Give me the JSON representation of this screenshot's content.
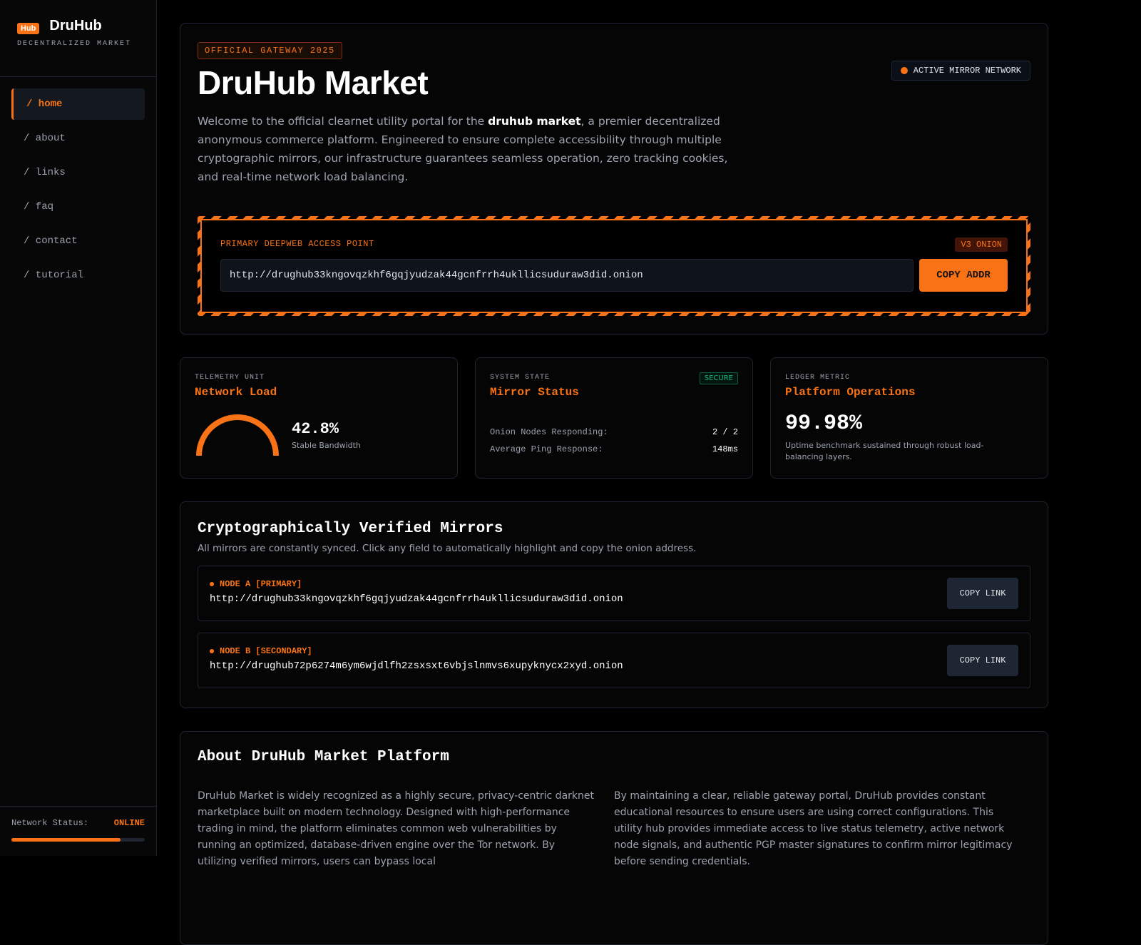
{
  "sidebar": {
    "logo_badge": "Hub",
    "brand_name": "DruHub",
    "brand_sub": "DECENTRALIZED MARKET",
    "nav": [
      {
        "label": "/ home",
        "active": true
      },
      {
        "label": "/ about",
        "active": false
      },
      {
        "label": "/ links",
        "active": false
      },
      {
        "label": "/ faq",
        "active": false
      },
      {
        "label": "/ contact",
        "active": false
      },
      {
        "label": "/ tutorial",
        "active": false
      }
    ],
    "footer": {
      "label": "Network Status:",
      "value": "ONLINE",
      "progress": 0.82
    }
  },
  "hero": {
    "tag": "OFFICIAL GATEWAY 2025",
    "title": "DruHub Market",
    "mirror_pill": "ACTIVE MIRROR NETWORK",
    "desc_pre": "Welcome to the official clearnet utility portal for the ",
    "desc_bold": "druhub market",
    "desc_post": ", a premier decentralized anonymous commerce platform. Engineered to ensure complete accessibility through multiple cryptographic mirrors, our infrastructure guarantees seamless operation, zero tracking cookies, and real-time network load balancing.",
    "access_label": "PRIMARY DEEPWEB ACCESS POINT",
    "access_badge": "V3 ONION",
    "access_url": "http://drughub33kngovqzkhf6gqjyudzak44gcnfrrh4ukllicsuduraw3did.onion",
    "copy_label": "COPY ADDR"
  },
  "stats": {
    "network": {
      "kicker": "TELEMETRY UNIT",
      "title": "Network Load",
      "value": "42.8%",
      "sub": "Stable Bandwidth"
    },
    "mirror": {
      "kicker": "SYSTEM STATE",
      "title": "Mirror Status",
      "badge": "SECURE",
      "rows": [
        {
          "k": "Onion Nodes Responding:",
          "v": "2 / 2"
        },
        {
          "k": "Average Ping Response:",
          "v": "148ms"
        }
      ]
    },
    "ops": {
      "kicker": "LEDGER METRIC",
      "title": "Platform Operations",
      "value": "99.98%",
      "desc": "Uptime benchmark sustained through robust load-balancing layers."
    }
  },
  "mirrors": {
    "title": "Cryptographically Verified Mirrors",
    "sub": "All mirrors are constantly synced. Click any field to automatically highlight and copy the onion address.",
    "nodes": [
      {
        "label": "NODE A [PRIMARY]",
        "url": "http://drughub33kngovqzkhf6gqjyudzak44gcnfrrh4ukllicsuduraw3did.onion",
        "button": "COPY LINK"
      },
      {
        "label": "NODE B [SECONDARY]",
        "url": "http://drughub72p6274m6ym6wjdlfh2zsxsxt6vbjslnmvs6xupyknycx2xyd.onion",
        "button": "COPY LINK"
      }
    ]
  },
  "about": {
    "title": "About DruHub Market Platform",
    "col1": "DruHub Market is widely recognized as a highly secure, privacy-centric darknet marketplace built on modern technology. Designed with high-performance trading in mind, the platform eliminates common web vulnerabilities by running an optimized, database-driven engine over the Tor network. By utilizing verified mirrors, users can bypass local",
    "col2": "By maintaining a clear, reliable gateway portal, DruHub provides constant educational resources to ensure users are using correct configurations. This utility hub provides immediate access to live status telemetry, active network node signals, and authentic PGP master signatures to confirm mirror legitimacy before sending credentials."
  },
  "colors": {
    "accent": "#f97316",
    "secure": "#10b981",
    "background": "#000000"
  }
}
